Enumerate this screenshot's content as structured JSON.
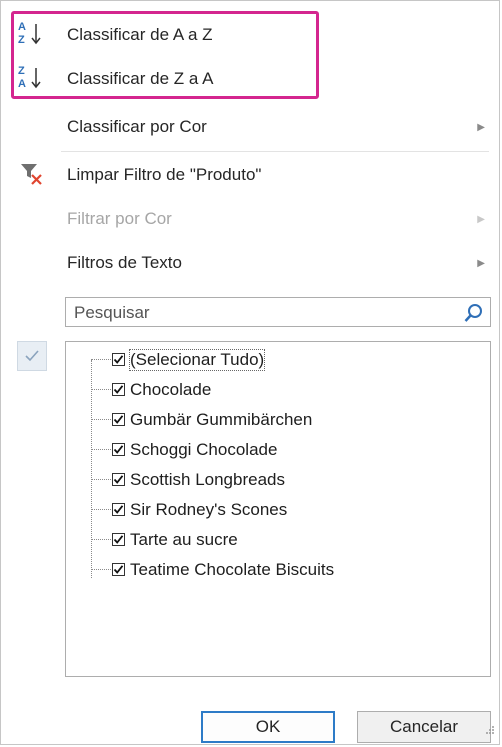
{
  "sort_menu": {
    "sort_az": "Classificar de A a Z",
    "sort_za": "Classificar de Z a A",
    "sort_by_color": "Classificar por Cor",
    "clear_filter": "Limpar Filtro de \"Produto\"",
    "filter_by_color": "Filtrar por Cor",
    "text_filters": "Filtros de Texto",
    "highlight_color": "#d4268f"
  },
  "icons": {
    "sort_az": "sort-ascending-icon",
    "sort_za": "sort-descending-icon",
    "clear_filter": "clear-filter-icon",
    "search": "search-icon",
    "submenu": "chevron-right-icon"
  },
  "search": {
    "placeholder": "Pesquisar"
  },
  "list": {
    "items": [
      {
        "label": "(Selecionar Tudo)",
        "checked": true
      },
      {
        "label": "Chocolade",
        "checked": true
      },
      {
        "label": "Gumbär Gummibärchen",
        "checked": true
      },
      {
        "label": "Schoggi Chocolade",
        "checked": true
      },
      {
        "label": "Scottish Longbreads",
        "checked": true
      },
      {
        "label": "Sir Rodney's Scones",
        "checked": true
      },
      {
        "label": "Tarte au sucre",
        "checked": true
      },
      {
        "label": "Teatime Chocolate Biscuits",
        "checked": true
      }
    ]
  },
  "buttons": {
    "ok": "OK",
    "cancel": "Cancelar"
  }
}
